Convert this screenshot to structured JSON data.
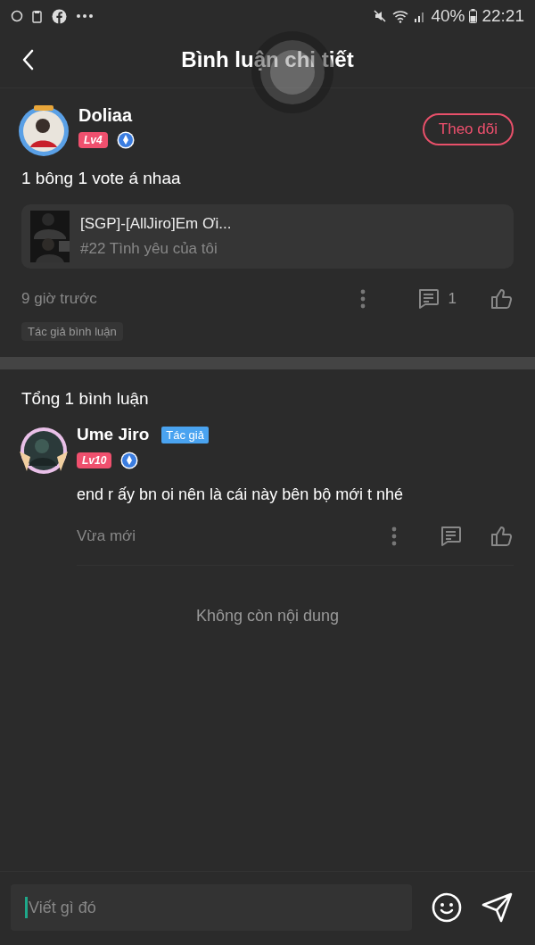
{
  "status_bar": {
    "battery": "40%",
    "time": "22:21"
  },
  "header": {
    "title": "Bình luận chi tiết"
  },
  "main_comment": {
    "author": "Doliaa",
    "level": "Lv4",
    "follow_button": "Theo dõi",
    "text": "1 bông 1 vote á nhaa",
    "story": {
      "kind": "picture",
      "title": "[SGP]-[AllJiro]Em Ơi...",
      "chapter": "#22 Tình yêu của tôi"
    },
    "time": "9 giờ trước",
    "reply_count": "1",
    "liked": false,
    "tag": "Tác giả bình luận"
  },
  "replies_header": "Tổng 1 bình luận",
  "replies": [
    {
      "author": "Ume Jiro",
      "author_badge": "Tác giả",
      "level": "Lv10",
      "text": "end r ấy bn oi nên là cái này bên bộ mới t nhé",
      "time": "Vừa mới",
      "liked": false
    }
  ],
  "end_text": "Không còn nội dung",
  "composer": {
    "placeholder": "Viết gì đó"
  }
}
